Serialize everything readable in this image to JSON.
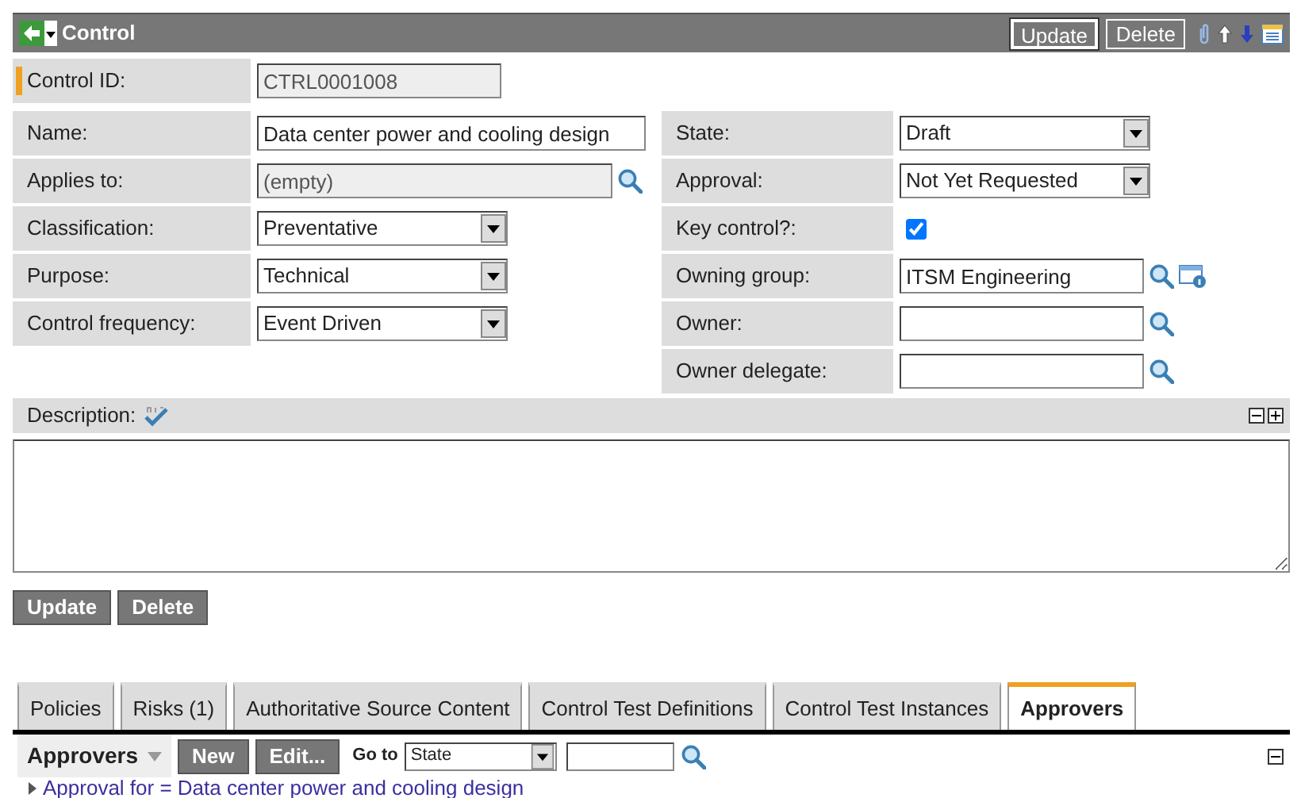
{
  "header": {
    "title": "Control",
    "buttons": [
      "Update",
      "Delete"
    ]
  },
  "control_id": {
    "label": "Control ID:",
    "kind": "readonly",
    "value": "CTRL0001008",
    "mandatory": true
  },
  "left_fields": [
    {
      "label": "Name:",
      "kind": "text",
      "value": "Data center power and cooling design"
    },
    {
      "label": "Applies to:",
      "kind": "reference_readonly",
      "value": "(empty)"
    },
    {
      "label": "Classification:",
      "kind": "select",
      "value": "Preventative"
    },
    {
      "label": "Purpose:",
      "kind": "select",
      "value": "Technical"
    },
    {
      "label": "Control frequency:",
      "kind": "select",
      "value": "Event Driven"
    }
  ],
  "right_fields": [
    {
      "label": "State:",
      "kind": "select",
      "value": "Draft"
    },
    {
      "label": "Approval:",
      "kind": "select",
      "value": "Not Yet Requested"
    },
    {
      "label": "Key control?:",
      "kind": "checkbox",
      "checked": true
    },
    {
      "label": "Owning group:",
      "kind": "reference_group",
      "value": "ITSM Engineering"
    },
    {
      "label": "Owner:",
      "kind": "reference"
    },
    {
      "label": "Owner delegate:",
      "kind": "reference"
    }
  ],
  "description": {
    "label": "Description:"
  },
  "buttons": [
    "Update",
    "Delete"
  ],
  "tabs": [
    {
      "label": "Policies",
      "selected": false
    },
    {
      "label": "Risks (1)",
      "selected": false
    },
    {
      "label": "Authoritative Source Content",
      "selected": false
    },
    {
      "label": "Control Test Definitions",
      "selected": false
    },
    {
      "label": "Control Test Instances",
      "selected": false
    },
    {
      "label": "Approvers",
      "selected": true
    }
  ],
  "related_list": {
    "menu": "Approvers",
    "buttons": [
      "New",
      "Edit..."
    ],
    "goto_label": "Go to",
    "goto_field": "State",
    "filter": "Approval for = Data center power and cooling design"
  }
}
